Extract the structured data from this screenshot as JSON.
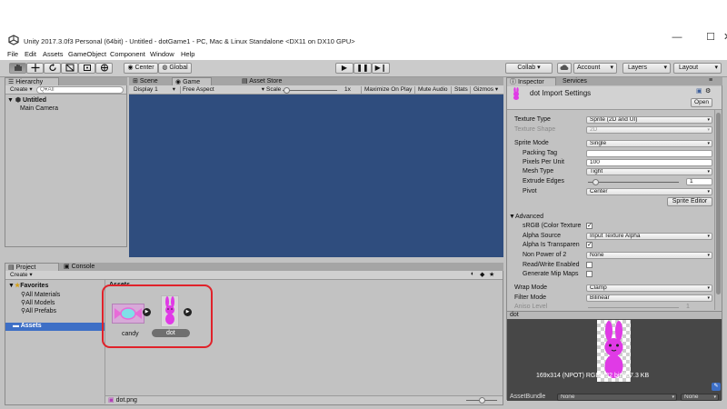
{
  "window": {
    "title": "Unity 2017.3.0f3 Personal (64bit) - Untitled - dotGame1 - PC, Mac & Linux Standalone <DX11 on DX10 GPU>",
    "minimize": "—",
    "maximize": "☐",
    "close": "✕"
  },
  "menu": [
    "File",
    "Edit",
    "Assets",
    "GameObject",
    "Component",
    "Window",
    "Help"
  ],
  "toolbar": {
    "pivot_center": "Center",
    "pivot_global": "Global",
    "collab": "Collab ▾",
    "account": "Account",
    "layers": "Layers",
    "layout": "Layout"
  },
  "hierarchy": {
    "tab": "Hierarchy",
    "create": "Create ▾",
    "search_placeholder": "Q▾All",
    "scene": "Untitled",
    "items": [
      "Main Camera"
    ]
  },
  "center_tabs": {
    "scene": "Scene",
    "game": "Game",
    "asset_store": "Asset Store"
  },
  "game_view": {
    "display": "Display 1",
    "aspect": "Free Aspect",
    "scale_label": "Scale",
    "scale_value": "1x",
    "maximize_on_play": "Maximize On Play",
    "mute_audio": "Mute Audio",
    "stats": "Stats",
    "gizmos": "Gizmos ▾",
    "background": "#2f4d7e"
  },
  "project": {
    "tab_project": "Project",
    "tab_console": "Console",
    "create": "Create ▾",
    "favorites_label": "Favorites",
    "favorites": [
      "All Materials",
      "All Models",
      "All Prefabs"
    ],
    "assets_root": "Assets",
    "breadcrumb": "Assets",
    "assets": [
      {
        "name": "candy",
        "selected": false
      },
      {
        "name": "dot",
        "selected": true
      }
    ],
    "footer_file": "dot.png"
  },
  "inspector": {
    "tab_inspector": "Inspector",
    "tab_services": "Services",
    "header_title": "dot Import Settings",
    "open_button": "Open",
    "rows": {
      "texture_type": {
        "label": "Texture Type",
        "value": "Sprite (2D and UI)"
      },
      "texture_shape": {
        "label": "Texture Shape",
        "value": "2D"
      },
      "sprite_mode": {
        "label": "Sprite Mode",
        "value": "Single"
      },
      "packing_tag": {
        "label": "Packing Tag",
        "value": ""
      },
      "pixels_per_unit": {
        "label": "Pixels Per Unit",
        "value": "100"
      },
      "mesh_type": {
        "label": "Mesh Type",
        "value": "Tight"
      },
      "extrude_edges": {
        "label": "Extrude Edges",
        "value": "1",
        "slider_fraction": 0.08
      },
      "pivot": {
        "label": "Pivot",
        "value": "Center"
      }
    },
    "sprite_editor": "Sprite Editor",
    "advanced_label": "Advanced",
    "advanced": {
      "srgb": {
        "label": "sRGB (Color Texture",
        "checked": true
      },
      "alpha_source": {
        "label": "Alpha Source",
        "value": "Input Texture Alpha"
      },
      "alpha_transparency": {
        "label": "Alpha Is Transparen",
        "checked": true
      },
      "non_power_of_2": {
        "label": "Non Power of 2",
        "value": "None"
      },
      "read_write": {
        "label": "Read/Write Enabled",
        "checked": false
      },
      "mip_maps": {
        "label": "Generate Mip Maps",
        "checked": false
      }
    },
    "wrap_mode": {
      "label": "Wrap Mode",
      "value": "Clamp"
    },
    "filter_mode": {
      "label": "Filter Mode",
      "value": "Bilinear"
    },
    "aniso_level": {
      "label": "Aniso Level",
      "value": "1"
    },
    "preview_title": "dot",
    "preview_info": "169x314 (NPOT)  RGBA 32 bit   207.3 KB",
    "assetbundle_label": "AssetBundle",
    "assetbundle_value": "None",
    "assetbundle_variant": "None"
  },
  "colors": {
    "accent_blue": "#3d6fc6",
    "highlight_red": "#e0222a",
    "bunny_pink": "#e03ae6"
  }
}
